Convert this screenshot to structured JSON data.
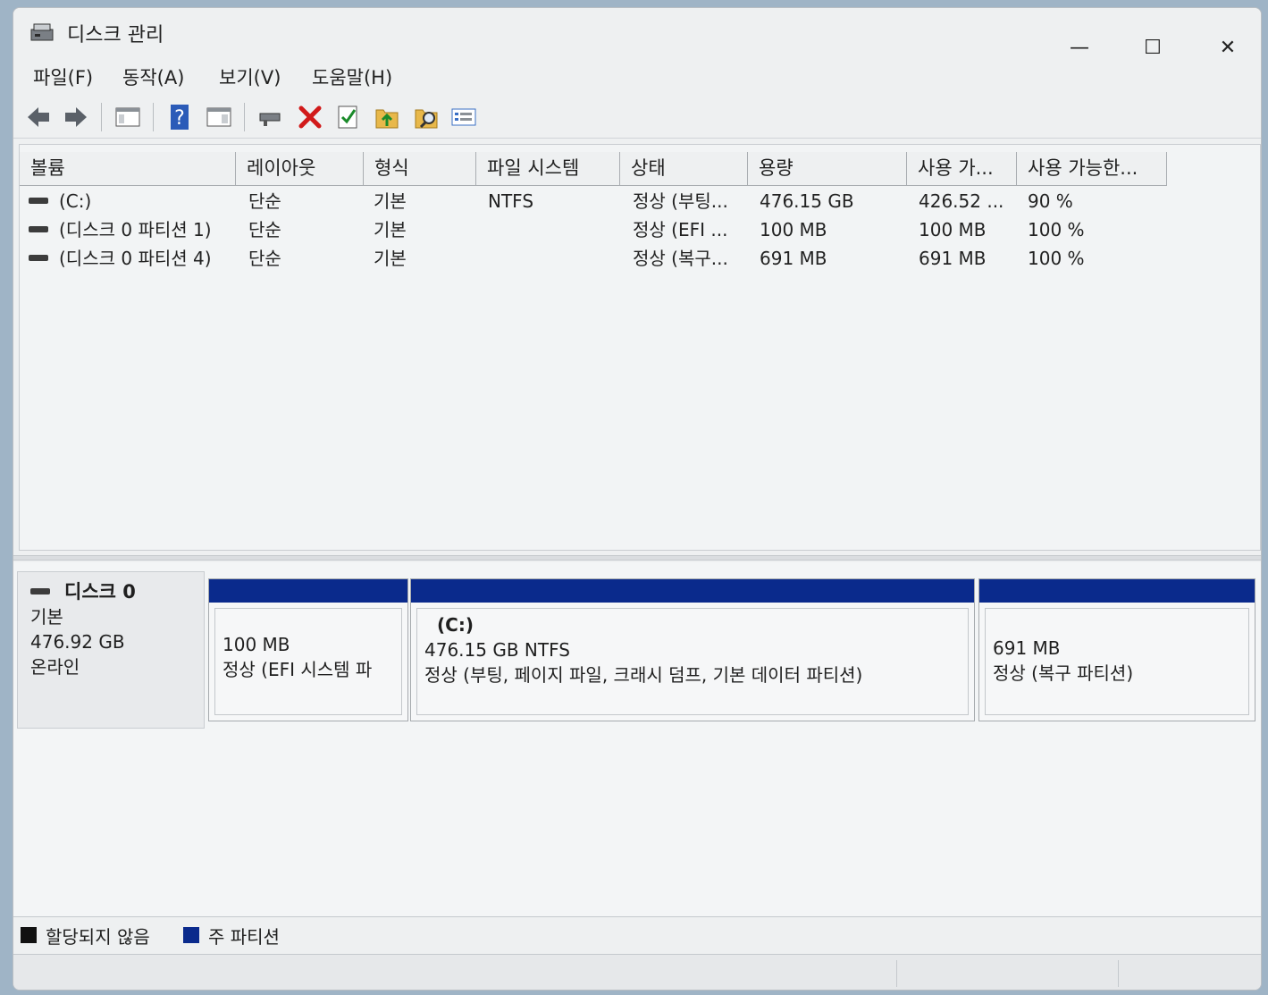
{
  "window": {
    "title": "디스크 관리"
  },
  "menu": [
    "파일(F)",
    "동작(A)",
    "보기(V)",
    "도움말(H)"
  ],
  "toolbar": [
    "back-icon",
    "forward-icon",
    "console-tree-icon",
    "help-icon",
    "action-pane-icon",
    "connect-disk-icon",
    "delete-icon",
    "check-icon",
    "import-icon",
    "search-icon",
    "properties-icon"
  ],
  "columns": [
    "볼륨",
    "레이아웃",
    "형식",
    "파일 시스템",
    "상태",
    "용량",
    "사용 가...",
    "사용 가능한..."
  ],
  "volumes": [
    {
      "name": "(C:)",
      "layout": "단순",
      "type": "기본",
      "fs": "NTFS",
      "status": "정상 (부팅...",
      "capacity": "476.15 GB",
      "free": "426.52 ...",
      "pct": "90 %"
    },
    {
      "name": "(디스크 0 파티션 1)",
      "layout": "단순",
      "type": "기본",
      "fs": "",
      "status": "정상 (EFI ...",
      "capacity": "100 MB",
      "free": "100 MB",
      "pct": "100 %"
    },
    {
      "name": "(디스크 0 파티션 4)",
      "layout": "단순",
      "type": "기본",
      "fs": "",
      "status": "정상 (복구...",
      "capacity": "691 MB",
      "free": "691 MB",
      "pct": "100 %"
    }
  ],
  "disk": {
    "name": "디스크 0",
    "type": "기본",
    "size": "476.92 GB",
    "state": "온라인",
    "partitions": [
      {
        "label": "",
        "size": "100 MB",
        "status": "정상 (EFI 시스템 파"
      },
      {
        "label": "(C:)",
        "size": "476.15 GB NTFS",
        "status": "정상 (부팅, 페이지 파일, 크래시 덤프, 기본 데이터 파티션)"
      },
      {
        "label": "",
        "size": "691 MB",
        "status": "정상 (복구 파티션)"
      }
    ]
  },
  "legend": {
    "unallocated": "할당되지 않음",
    "primary": "주 파티션",
    "unallocated_color": "#111111",
    "primary_color": "#0a2a8c"
  }
}
